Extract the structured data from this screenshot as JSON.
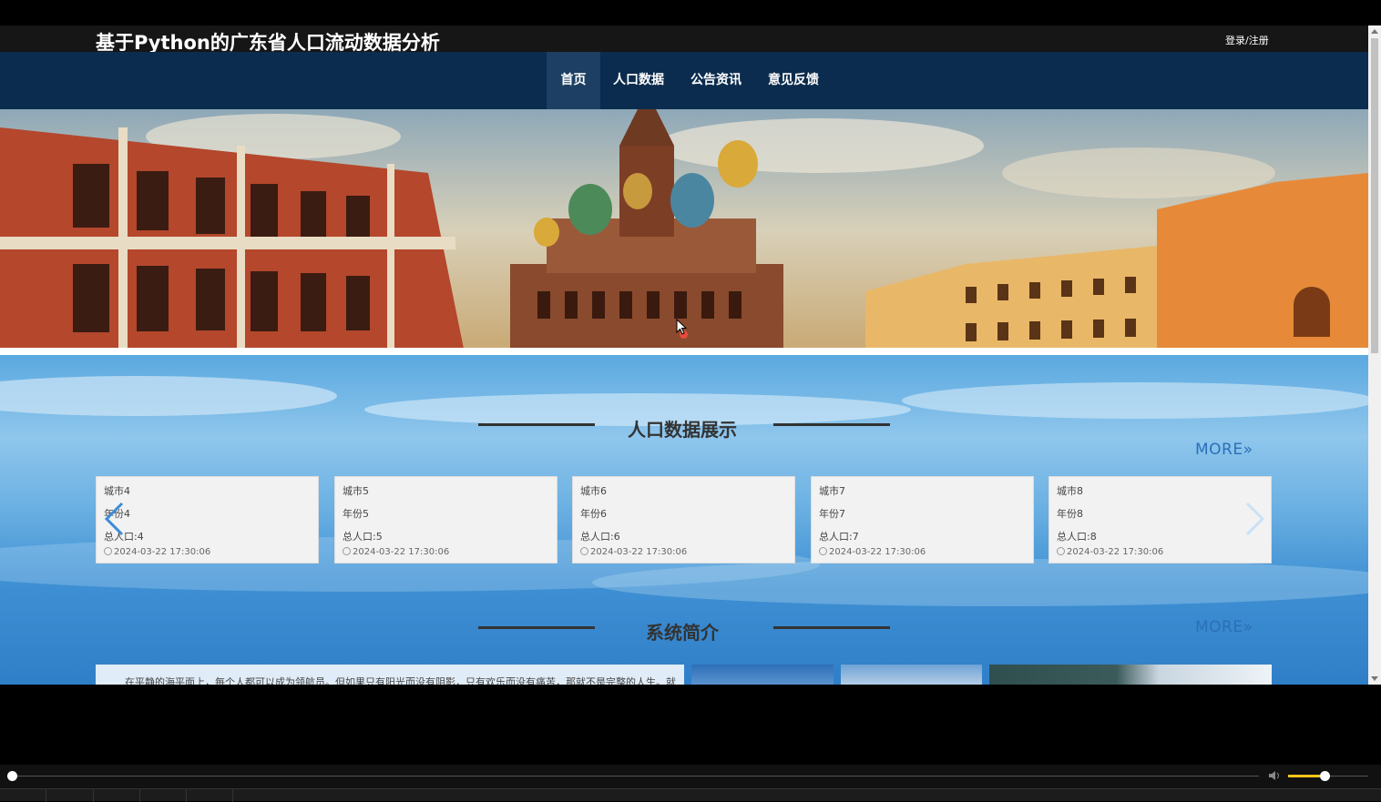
{
  "header": {
    "site_title": "基于Python的广东省人口流动数据分析",
    "login_label": "登录/注册"
  },
  "nav": {
    "items": [
      {
        "label": "首页",
        "active": true
      },
      {
        "label": "人口数据",
        "active": false
      },
      {
        "label": "公告资讯",
        "active": false
      },
      {
        "label": "意见反馈",
        "active": false
      }
    ]
  },
  "banner": {
    "slide_indicator_color": "#e74c3c",
    "active_slide": 1,
    "slide_count": 1
  },
  "population_section": {
    "title": "人口数据展示",
    "more_label": "MORE»",
    "cards": [
      {
        "city": "城市4",
        "year": "年份4",
        "total": "总人口:4",
        "time": "2024-03-22 17:30:06"
      },
      {
        "city": "城市5",
        "year": "年份5",
        "total": "总人口:5",
        "time": "2024-03-22 17:30:06"
      },
      {
        "city": "城市6",
        "year": "年份6",
        "total": "总人口:6",
        "time": "2024-03-22 17:30:06"
      },
      {
        "city": "城市7",
        "year": "年份7",
        "total": "总人口:7",
        "time": "2024-03-22 17:30:06"
      },
      {
        "city": "城市8",
        "year": "年份8",
        "total": "总人口:8",
        "time": "2024-03-22 17:30:06"
      }
    ],
    "prev_icon": "chevron-left-icon",
    "next_icon": "chevron-right-icon"
  },
  "intro_section": {
    "title": "系统简介",
    "more_label": "MORE»",
    "text": "在平静的海平面上，每个人都可以成为领航员。但如果只有阳光而没有阴影，只有欢乐而没有痛苦，那就不是完整的人生。就拿最幸福的人来说吧——他的幸福是一团纠结的纱线。痛苦和幸福轮番而至，让我们悲喜交集，甚至死亡都让人生更加可爱。"
  },
  "player": {
    "seek_position": 0,
    "volume_level": 0.45,
    "accent_color": "#f5c518"
  },
  "colors": {
    "nav_bg": "#0b2c4e",
    "topbar_bg": "#161616",
    "more_link": "#2a6fb8"
  }
}
